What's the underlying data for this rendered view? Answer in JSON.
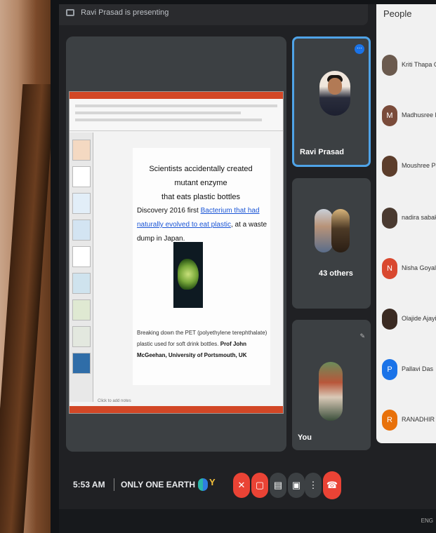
{
  "top_strip": {
    "text": "Ravi Prasad is presenting"
  },
  "slide": {
    "heading_line1": "Scientists accidentally created mutant enzyme",
    "heading_line2": "that eats plastic bottles",
    "discovery_prefix": "Discovery 2016 first ",
    "discovery_link": "Bacterium that had naturally evolved to eat plastic",
    "discovery_suffix": ", at a waste dump in Japan.",
    "caption": "Breaking down the PET (polyethylene terephthalate) plastic used for soft drink bottles. ",
    "credit": "Prof John McGeehan, University of Portsmouth, UK",
    "notes_hint": "Click to add notes"
  },
  "tiles": {
    "presenter": {
      "name": "Ravi Prasad",
      "more_icon": "more-vert-icon"
    },
    "others": {
      "label": "43 others"
    },
    "self": {
      "name": "You"
    }
  },
  "people": {
    "title": "People",
    "list": [
      {
        "initial": "",
        "name": "Kriti Thapa Chettri",
        "color": "#6b5a4e"
      },
      {
        "initial": "M",
        "name": "Madhusree Dutta",
        "color": "#7a4b3a"
      },
      {
        "initial": "",
        "name": "Moushree Pakray",
        "color": "#5c3d2b"
      },
      {
        "initial": "",
        "name": "nadira sabaka",
        "color": "#4a3a30"
      },
      {
        "initial": "N",
        "name": "Nisha Goyal",
        "color": "#d9482f"
      },
      {
        "initial": "",
        "name": "Olajide Ajayi",
        "color": "#3a2a22"
      },
      {
        "initial": "P",
        "name": "Pallavi Das",
        "color": "#1a73e8"
      },
      {
        "initial": "R",
        "name": "RANADHIR CHAK",
        "color": "#e8710a"
      }
    ]
  },
  "bottom_bar": {
    "time": "5:53 AM",
    "meeting_name": "ONLY ONE EARTH",
    "controls": [
      "mic-off-icon",
      "camera-off-icon",
      "captions-icon",
      "present-icon",
      "more-options-icon"
    ],
    "hangup_icon": "hang-up-icon"
  },
  "taskbar": {
    "lang": "ENG"
  }
}
